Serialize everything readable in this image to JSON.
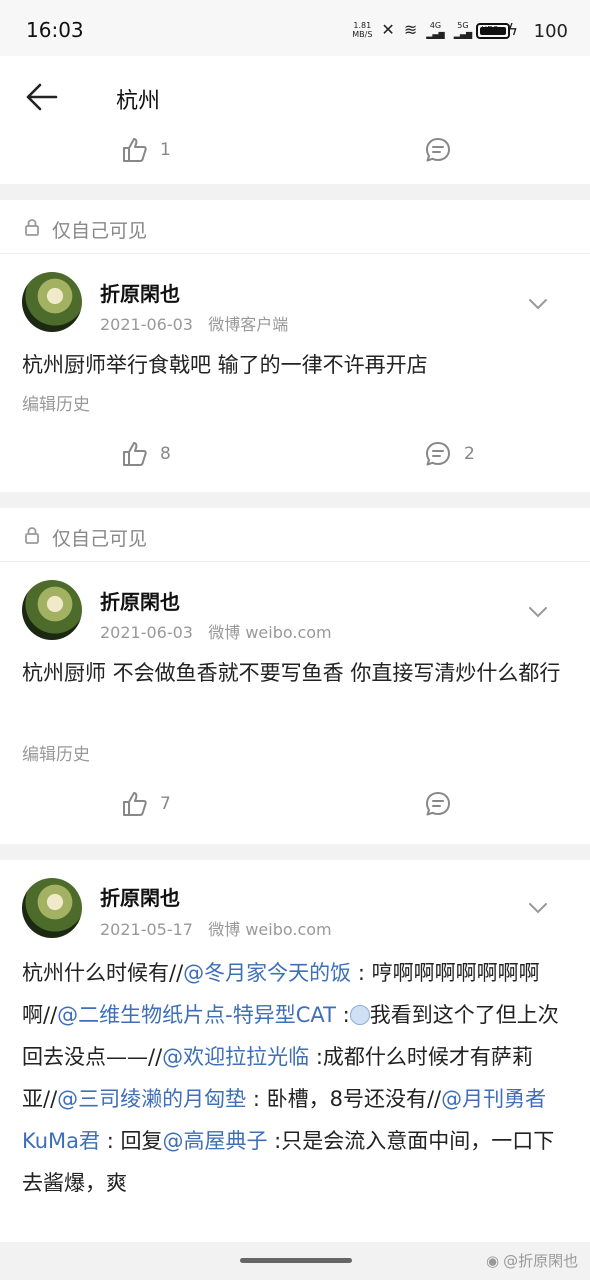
{
  "status": {
    "time": "16:03",
    "net_speed": "1.81",
    "net_unit": "MB/S",
    "battery": "100",
    "sig1": "4G",
    "sig2": "5G",
    "hd": "HD2"
  },
  "header": {
    "title": "杭州"
  },
  "top_partial": {
    "likes": "1"
  },
  "posts": [
    {
      "visibility": "仅自己可见",
      "author": "折原閑也",
      "date": "2021-06-03",
      "source": "微博客户端",
      "text": "杭州厨师举行食戟吧 输了的一律不许再开店",
      "edit_label": "编辑历史",
      "likes": "8",
      "comments": "2"
    },
    {
      "visibility": "仅自己可见",
      "author": "折原閑也",
      "date": "2021-06-03",
      "source": "微博 weibo.com",
      "text": "杭州厨师 不会做鱼香就不要写鱼香 你直接写清炒什么都行",
      "edit_label": "编辑历史",
      "likes": "7",
      "comments": ""
    },
    {
      "author": "折原閑也",
      "date": "2021-05-17",
      "source": "微博 weibo.com",
      "segments": [
        "杭州什么时候有//",
        "@冬月家今天的饭",
        " : 哼啊啊啊啊啊啊啊啊//",
        "@二维生物纸片点-特异型CAT",
        " :",
        "我看到这个了但上次回去没点——//",
        "@欢迎拉拉光临",
        " :成都什么时候才有萨莉亚//",
        "@三司绫濑的月匈垫",
        " : 卧槽，8号还没有//",
        "@月刊勇者KuMa君",
        " : 回复",
        "@高屋典子",
        " :只是会流入意面中间，一口下去酱爆，爽"
      ]
    }
  ],
  "watermark": "@折原閑也"
}
